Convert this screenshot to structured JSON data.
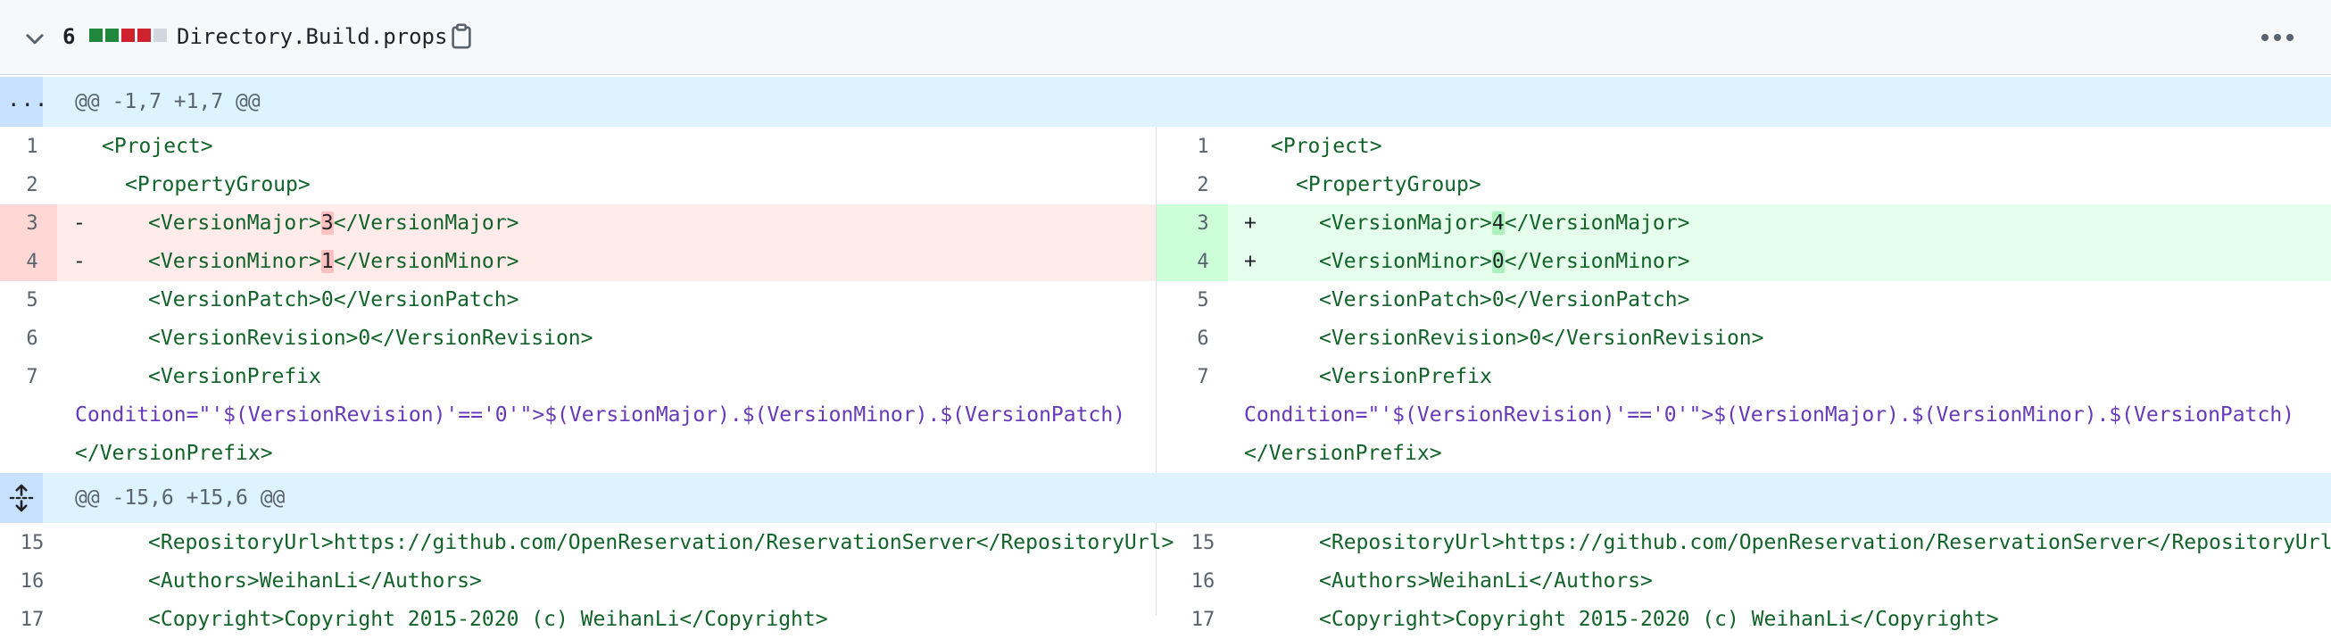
{
  "file": {
    "change_count": "6",
    "name": "Directory.Build.props",
    "diffstat_colors": [
      "#1f883d",
      "#1f883d",
      "#cf222e",
      "#cf222e",
      "#d0d7de"
    ]
  },
  "hunks": [
    {
      "expander": "...",
      "header": "@@ -1,7 +1,7 @@"
    },
    {
      "expander": "expand-icon",
      "header": "@@ -15,6 +15,6 @@"
    }
  ],
  "left": {
    "n1": "1",
    "n2": "2",
    "n3": "3",
    "n4": "4",
    "n5": "5",
    "n6": "6",
    "n7": "7",
    "n15": "15",
    "n16": "16",
    "n17": "17",
    "l1": "<Project>",
    "l2": "<PropertyGroup>",
    "l3a": "<VersionMajor>",
    "l3b": "3",
    "l3c": "</VersionMajor>",
    "l4a": "<VersionMinor>",
    "l4b": "1",
    "l4c": "</VersionMinor>",
    "l5": "<VersionPatch>0</VersionPatch>",
    "l6": "<VersionRevision>0</VersionRevision>",
    "l7": "<VersionPrefix",
    "l7b": "Condition=\"'$(VersionRevision)'=='0'\">$(VersionMajor).$(VersionMinor).$(VersionPatch)",
    "l7c": "</VersionPrefix>",
    "l15": "<RepositoryUrl>https://github.com/OpenReservation/ReservationServer</RepositoryUrl>",
    "l16": "<Authors>WeihanLi</Authors>",
    "l17": "<Copyright>Copyright 2015-2020 (c) WeihanLi</Copyright>"
  },
  "right": {
    "l3b": "4",
    "l4b": "0"
  },
  "markers": {
    "del": "-",
    "add": "+"
  }
}
